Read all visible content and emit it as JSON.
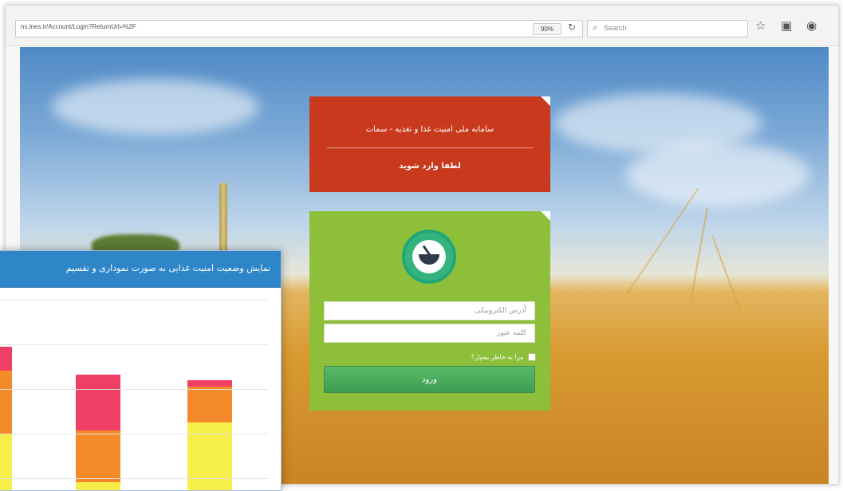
{
  "browser": {
    "url": "ns.lnes.ir/Account/Login?ReturnUrl=%2F",
    "zoom": "90%",
    "search_placeholder": "Search",
    "icons": [
      "reload-icon",
      "search-icon",
      "star-icon",
      "clipboard-icon",
      "pocket-icon"
    ]
  },
  "banner": {
    "title": "سامانه ملی امنیت غذا و تغذیه - سمات",
    "subtitle": "لطفا وارد شوید"
  },
  "login": {
    "email_placeholder": "آدرس الکترونیکی",
    "password_placeholder": "کلمه عبور",
    "remember_label": "مرا به خاطر بسپار؟",
    "submit_label": "ورود"
  },
  "chart_window": {
    "title": "نمایش وضعیت امنیت غذایی به صورت نموداری و تقسیم"
  },
  "chart_data": {
    "type": "bar",
    "stacked": true,
    "categories": [
      "",
      "",
      ""
    ],
    "series": [
      {
        "color": "#f6ee4b",
        "values": [
          70,
          10,
          85
        ]
      },
      {
        "color": "#f58a2a",
        "values": [
          80,
          65,
          45
        ]
      },
      {
        "color": "#ef3f65",
        "values": [
          30,
          70,
          8
        ]
      }
    ],
    "grid": true,
    "colors": {
      "header": "#2e86c9"
    }
  },
  "colors": {
    "title_card": "#c8391d",
    "login_card": "#8dbf3a",
    "button": "#4aa95b"
  }
}
